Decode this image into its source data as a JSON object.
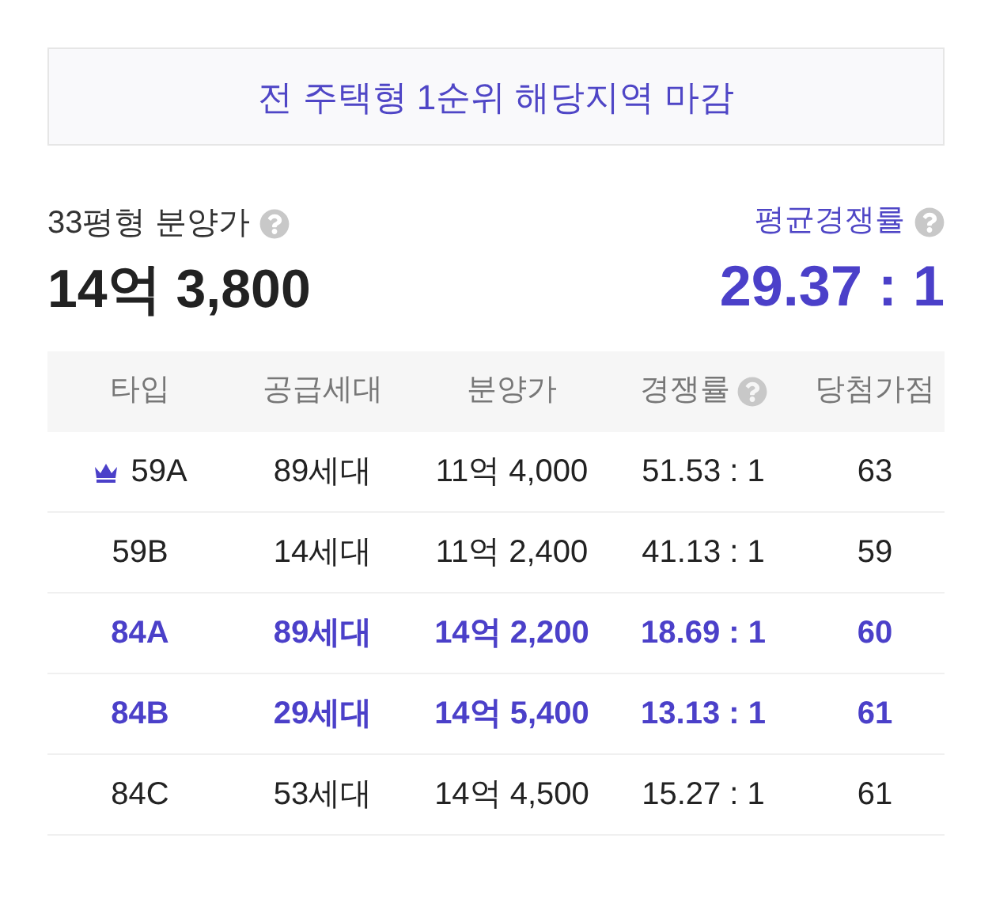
{
  "notice": "전 주택형 1순위 해당지역 마감",
  "price": {
    "label": "33평형 분양가",
    "value": "14억 3,800"
  },
  "competition": {
    "label": "평균경쟁률",
    "value": "29.37 : 1"
  },
  "table": {
    "columns": [
      {
        "label": "타입",
        "help": false
      },
      {
        "label": "공급세대",
        "help": false
      },
      {
        "label": "분양가",
        "help": false
      },
      {
        "label": "경쟁률",
        "help": true
      },
      {
        "label": "당첨가점",
        "help": false
      }
    ],
    "rows": [
      {
        "selected": false,
        "crowned": true,
        "cells": [
          "59A",
          "89세대",
          "11억 4,000",
          "51.53 : 1",
          "63"
        ]
      },
      {
        "selected": false,
        "crowned": false,
        "cells": [
          "59B",
          "14세대",
          "11억 2,400",
          "41.13 : 1",
          "59"
        ]
      },
      {
        "selected": true,
        "crowned": false,
        "cells": [
          "84A",
          "89세대",
          "14억 2,200",
          "18.69 : 1",
          "60"
        ]
      },
      {
        "selected": true,
        "crowned": false,
        "cells": [
          "84B",
          "29세대",
          "14억 5,400",
          "13.13 : 1",
          "61"
        ]
      },
      {
        "selected": false,
        "crowned": false,
        "cells": [
          "84C",
          "53세대",
          "14억 4,500",
          "15.27 : 1",
          "61"
        ]
      }
    ]
  }
}
